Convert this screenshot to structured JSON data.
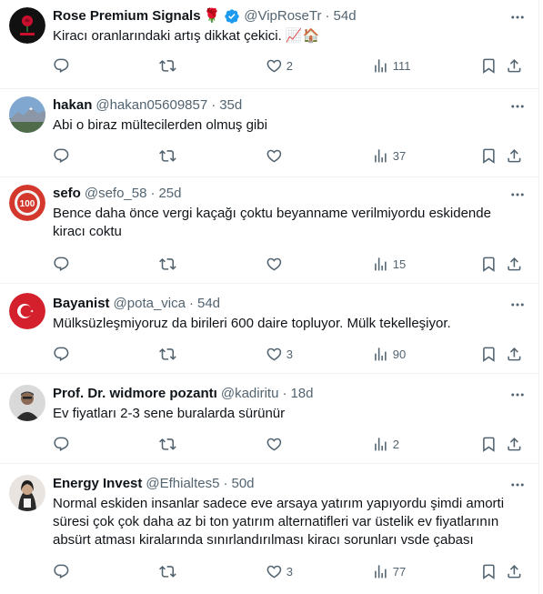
{
  "tweets": [
    {
      "name": "Rose Premium Signals",
      "name_emoji": "🌹",
      "verified": true,
      "handle": "@VipRoseTr",
      "time": "54d",
      "text": "Kiracı oranlarındaki artış dikkat çekici. 📈🏠",
      "replies": "",
      "retweets": "",
      "likes": "2",
      "views": "111",
      "avatar_icon": "rose-logo"
    },
    {
      "name": "hakan",
      "handle": "@hakan05609857",
      "time": "35d",
      "text": "Abi o biraz mültecilerden olmuş gibi",
      "replies": "",
      "retweets": "",
      "likes": "",
      "views": "37",
      "avatar_icon": "mountain-landscape"
    },
    {
      "name": "sefo",
      "handle": "@sefo_58",
      "time": "25d",
      "text": "Bence daha önce vergi kaçağı çoktu beyanname verilmiyordu eskidende kiracı coktu",
      "replies": "",
      "retweets": "",
      "likes": "",
      "views": "15",
      "avatar_icon": "red-emblem"
    },
    {
      "name": "Bayanist",
      "handle": "@pota_vica",
      "time": "54d",
      "text": "Mülksüzleşmiyoruz da birileri 600 daire topluyor. Mülk tekelleşiyor.",
      "replies": "",
      "retweets": "",
      "likes": "3",
      "views": "90",
      "avatar_icon": "turkish-flag"
    },
    {
      "name": "Prof. Dr. widmore pozantı",
      "handle": "@kadiritu",
      "time": "18d",
      "text": "Ev fiyatları 2-3 sene buralarda sürünür",
      "replies": "",
      "retweets": "",
      "likes": "",
      "views": "2",
      "avatar_icon": "person-photo"
    },
    {
      "name": "Energy Invest",
      "handle": "@Efhialtes5",
      "time": "50d",
      "text": "Normal eskiden insanlar sadece eve arsaya yatırım yapıyordu şimdi amorti süresi çok çok daha az bi ton yatırım alternatifleri var üstelik ev fiyatlarının absürt atması kiralarında sınırlandırılması kiracı sorunları vsde çabası",
      "replies": "",
      "retweets": "",
      "likes": "3",
      "views": "77",
      "avatar_icon": "person-photo"
    }
  ],
  "colors": {
    "text": "#0f1419",
    "secondary": "#536471",
    "verified": "#1d9bf0",
    "divider": "#eff3f4"
  }
}
